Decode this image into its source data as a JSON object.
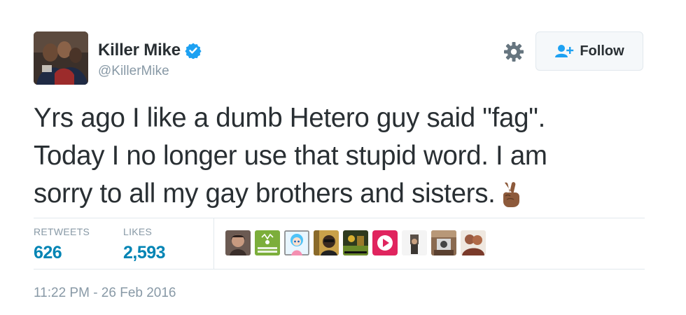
{
  "user": {
    "display_name": "Killer Mike",
    "handle": "@KillerMike",
    "verified": true,
    "avatar_icon": "profile-photo"
  },
  "actions": {
    "settings_icon": "gear-icon",
    "follow_label": "Follow",
    "follow_icon": "add-user-icon"
  },
  "tweet": {
    "text": "Yrs ago I like a dumb Hetero guy said \"fag\".\nToday I no longer use that stupid word.  I am\nsorry to all my gay brothers and sisters.",
    "emoji": "victory-hand-medium-dark-skin-tone"
  },
  "stats": {
    "retweets_label": "RETWEETS",
    "retweets_value": "626",
    "likes_label": "LIKES",
    "likes_value": "2,593"
  },
  "liker_avatars": [
    {
      "name": "liker-avatar-1",
      "color": "#5a4a45"
    },
    {
      "name": "liker-avatar-2",
      "color": "#7cae3b",
      "caption": "COMMIT RESPOND"
    },
    {
      "name": "liker-avatar-3",
      "color": "#dff3ff"
    },
    {
      "name": "liker-avatar-4",
      "color": "#c9a14a"
    },
    {
      "name": "liker-avatar-5",
      "color": "#2a2a2a"
    },
    {
      "name": "liker-avatar-6",
      "color": "#4e7a2e"
    },
    {
      "name": "liker-avatar-7",
      "color": "#e0245e"
    },
    {
      "name": "liker-avatar-8",
      "color": "#f2f2f2"
    },
    {
      "name": "liker-avatar-9",
      "color": "#7b5a45"
    },
    {
      "name": "liker-avatar-10",
      "color": "#8a5a48"
    }
  ],
  "timestamp": "11:22 PM - 26 Feb 2016",
  "colors": {
    "link_blue": "#0084b4",
    "verified_blue": "#1da1f2",
    "muted_gray": "#8899a6",
    "text_dark": "#292f33"
  }
}
